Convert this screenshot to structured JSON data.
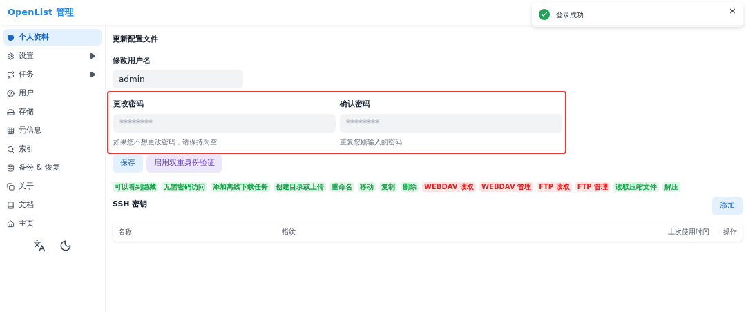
{
  "header": {
    "brand": "OpenList 管理"
  },
  "sidebar": {
    "items": [
      {
        "label": "个人资料",
        "selected": true,
        "kind": "link"
      },
      {
        "label": "设置",
        "selected": false,
        "kind": "group"
      },
      {
        "label": "任务",
        "selected": false,
        "kind": "group"
      },
      {
        "label": "用户",
        "selected": false,
        "kind": "link"
      },
      {
        "label": "存储",
        "selected": false,
        "kind": "link"
      },
      {
        "label": "元信息",
        "selected": false,
        "kind": "link"
      },
      {
        "label": "索引",
        "selected": false,
        "kind": "link"
      },
      {
        "label": "备份 & 恢复",
        "selected": false,
        "kind": "link"
      },
      {
        "label": "关于",
        "selected": false,
        "kind": "link"
      },
      {
        "label": "文档",
        "selected": false,
        "kind": "link"
      },
      {
        "label": "主页",
        "selected": false,
        "kind": "link"
      }
    ]
  },
  "toast": {
    "message": "登录成功",
    "close": "×"
  },
  "profile": {
    "title": "更新配置文件",
    "username": {
      "label": "修改用户名",
      "value": "admin"
    },
    "password": {
      "label": "更改密码",
      "placeholder": "********",
      "hint": "如果您不想更改密码，请保持为空"
    },
    "confirm": {
      "label": "确认密码",
      "placeholder": "********",
      "hint": "重复您刚输入的密码"
    },
    "buttons": [
      "保存",
      "启用双重身份验证"
    ],
    "permissions": [
      {
        "label": "可以看到隐藏",
        "color": "#16a34a"
      },
      {
        "label": "无需密码访问",
        "color": "#16a34a"
      },
      {
        "label": "添加离线下载任务",
        "color": "#16a34a"
      },
      {
        "label": "创建目录或上传",
        "color": "#16a34a"
      },
      {
        "label": "重命名",
        "color": "#16a34a"
      },
      {
        "label": "移动",
        "color": "#16a34a"
      },
      {
        "label": "复制",
        "color": "#16a34a"
      },
      {
        "label": "删除",
        "color": "#16a34a"
      },
      {
        "label": "WEBDAV 读取",
        "color": "#dc2626"
      },
      {
        "label": "WEBDAV 管理",
        "color": "#dc2626"
      },
      {
        "label": "FTP 读取",
        "color": "#dc2626"
      },
      {
        "label": "FTP 管理",
        "color": "#dc2626"
      },
      {
        "label": "读取压缩文件",
        "color": "#16a34a"
      },
      {
        "label": "解压",
        "color": "#16a34a"
      }
    ]
  },
  "ssh": {
    "title": "SSH 密钥",
    "add": "添加",
    "columns": [
      "名称",
      "指纹",
      "上次使用时间",
      "操作"
    ]
  }
}
